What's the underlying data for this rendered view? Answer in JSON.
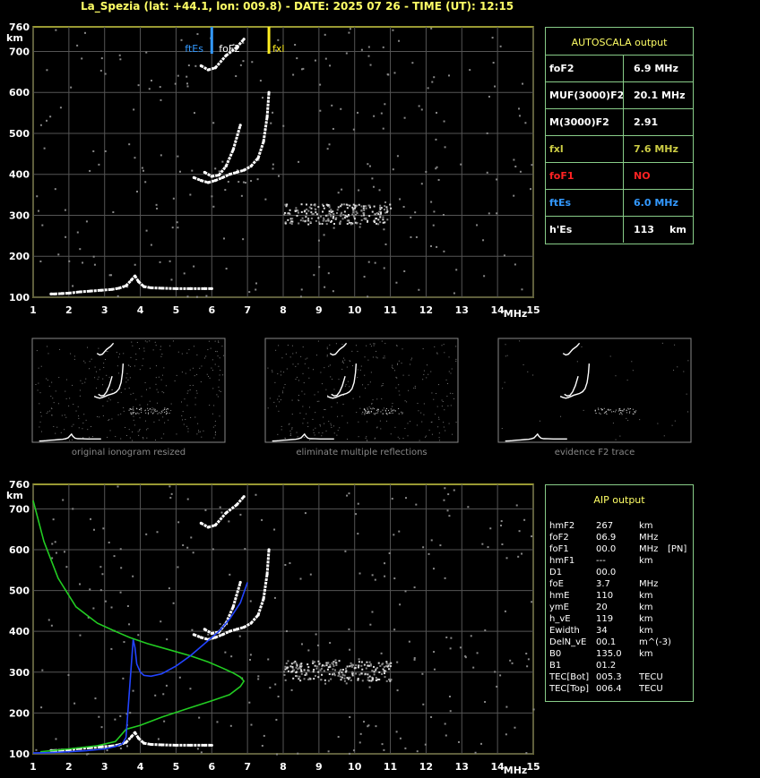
{
  "header": {
    "title": "La_Spezia (lat: +44.1, lon: 009.8) - DATE: 2025 07 26 - TIME (UT): 12:15"
  },
  "axes": {
    "y_unit": "km",
    "x_unit": "MHz",
    "y_ticks": [
      "100",
      "200",
      "300",
      "400",
      "500",
      "600",
      "700",
      "760"
    ],
    "x_ticks": [
      "1",
      "2",
      "3",
      "4",
      "5",
      "6",
      "7",
      "8",
      "9",
      "10",
      "11",
      "12",
      "13",
      "14",
      "15"
    ]
  },
  "markers": {
    "ftEs_label": "ftEs",
    "foF2_label": "foF2",
    "fxl_label": "fxl"
  },
  "autoscala": {
    "title": "AUTOSCALA output",
    "rows": [
      {
        "name": "foF2",
        "value": "6.9 MHz",
        "color": "#ffffff"
      },
      {
        "name": "MUF(3000)F2",
        "value": "20.1 MHz",
        "color": "#ffffff"
      },
      {
        "name": "M(3000)F2",
        "value": "2.91",
        "color": "#ffffff"
      },
      {
        "name": "fxl",
        "value": "7.6 MHz",
        "color": "#cccc44"
      },
      {
        "name": "foF1",
        "value": "NO",
        "color": "#ff2222"
      },
      {
        "name": "ftEs",
        "value": "6.0 MHz",
        "color": "#3399ff"
      },
      {
        "name": "h'Es",
        "value": "113",
        "unit": "km",
        "color": "#ffffff"
      }
    ]
  },
  "thumbnails": [
    {
      "caption": "original ionogram resized"
    },
    {
      "caption": "eliminate multiple reflections"
    },
    {
      "caption": "evidence F2 trace"
    }
  ],
  "aip": {
    "title": "AIP output",
    "rows": [
      {
        "name": "hmF2",
        "value": "267",
        "unit": "km",
        "extra": ""
      },
      {
        "name": "foF2",
        "value": "06.9",
        "unit": "MHz",
        "extra": ""
      },
      {
        "name": "foF1",
        "value": "00.0",
        "unit": "MHz",
        "extra": "[PN]"
      },
      {
        "name": "hmF1",
        "value": "---",
        "unit": "km",
        "extra": ""
      },
      {
        "name": "D1",
        "value": "00.0",
        "unit": "",
        "extra": ""
      },
      {
        "name": "foE",
        "value": "3.7",
        "unit": "MHz",
        "extra": ""
      },
      {
        "name": "hmE",
        "value": "110",
        "unit": "km",
        "extra": ""
      },
      {
        "name": "ymE",
        "value": "20",
        "unit": "km",
        "extra": ""
      },
      {
        "name": "h_vE",
        "value": "119",
        "unit": "km",
        "extra": ""
      },
      {
        "name": "Ewidth",
        "value": "34",
        "unit": "km",
        "extra": ""
      },
      {
        "name": "DelN_vE",
        "value": "00.1",
        "unit": "m^(-3)",
        "extra": ""
      },
      {
        "name": "B0",
        "value": "135.0",
        "unit": "km",
        "extra": ""
      },
      {
        "name": "B1",
        "value": "01.2",
        "unit": "",
        "extra": ""
      },
      {
        "name": "TEC[Bot]",
        "value": "005.3",
        "unit": "TECU",
        "extra": ""
      },
      {
        "name": "TEC[Top]",
        "value": "006.4",
        "unit": "TECU",
        "extra": ""
      }
    ]
  },
  "chart_data": [
    {
      "type": "scatter",
      "title": "",
      "xlabel": "MHz",
      "ylabel": "km",
      "xlim": [
        1,
        15
      ],
      "ylim": [
        100,
        760
      ],
      "grid": true,
      "series": [
        {
          "name": "",
          "color": "#ffffff",
          "x": [
            1.5,
            1.6,
            1.8,
            2.0,
            2.3,
            2.6,
            2.9,
            3.2,
            3.4,
            3.6,
            3.75,
            3.85,
            3.95,
            4.1,
            4.3,
            4.6,
            5.0,
            5.4,
            5.8,
            6.0
          ],
          "y": [
            108,
            108,
            109,
            110,
            113,
            115,
            117,
            119,
            122,
            128,
            142,
            152,
            138,
            126,
            123,
            122,
            121,
            121,
            121,
            121
          ]
        },
        {
          "name": "",
          "color": "#ffffff",
          "x": [
            5.5,
            5.7,
            5.9,
            6.1,
            6.3,
            6.5,
            6.7,
            6.9,
            7.1,
            7.3,
            7.45,
            7.55,
            7.6
          ],
          "y": [
            392,
            385,
            380,
            385,
            392,
            400,
            405,
            410,
            420,
            440,
            480,
            540,
            600
          ]
        },
        {
          "name": "",
          "color": "#ffffff",
          "x": [
            5.8,
            6.0,
            6.2,
            6.4,
            6.6,
            6.8
          ],
          "y": [
            405,
            395,
            398,
            420,
            460,
            520
          ]
        },
        {
          "name": "",
          "color": "#ffffff",
          "x": [
            5.7,
            5.9,
            6.1,
            6.4,
            6.7,
            6.9
          ],
          "y": [
            665,
            655,
            660,
            690,
            710,
            730
          ]
        }
      ]
    },
    {
      "type": "line",
      "title": "",
      "xlabel": "MHz",
      "ylabel": "km",
      "xlim": [
        1,
        15
      ],
      "ylim": [
        100,
        760
      ],
      "grid": true,
      "series": [
        {
          "name": "",
          "color": "#22cc22",
          "x": [
            1.0,
            1.3,
            1.7,
            2.2,
            2.8,
            3.3,
            3.7,
            4.2,
            4.8,
            5.4,
            5.9,
            6.3,
            6.6,
            6.8,
            6.9,
            6.8,
            6.5,
            6.0,
            5.3,
            4.6,
            4.0,
            3.6,
            3.4,
            3.3,
            2.8,
            2.0,
            1.2
          ],
          "y": [
            720,
            620,
            530,
            460,
            420,
            400,
            385,
            370,
            355,
            340,
            325,
            310,
            298,
            288,
            278,
            265,
            245,
            230,
            210,
            190,
            170,
            160,
            140,
            130,
            120,
            112,
            105
          ]
        },
        {
          "name": "",
          "color": "#2244ff",
          "x": [
            1.0,
            1.5,
            2.0,
            2.5,
            3.0,
            3.3,
            3.5,
            3.6,
            3.8,
            3.85,
            3.9,
            4.0,
            4.1,
            4.3,
            4.6,
            5.0,
            5.4,
            5.8,
            6.2,
            6.5,
            6.8,
            7.0
          ],
          "y": [
            102,
            103,
            105,
            108,
            112,
            118,
            125,
            140,
            380,
            360,
            320,
            300,
            292,
            290,
            296,
            315,
            340,
            370,
            400,
            430,
            470,
            520
          ]
        }
      ]
    }
  ]
}
